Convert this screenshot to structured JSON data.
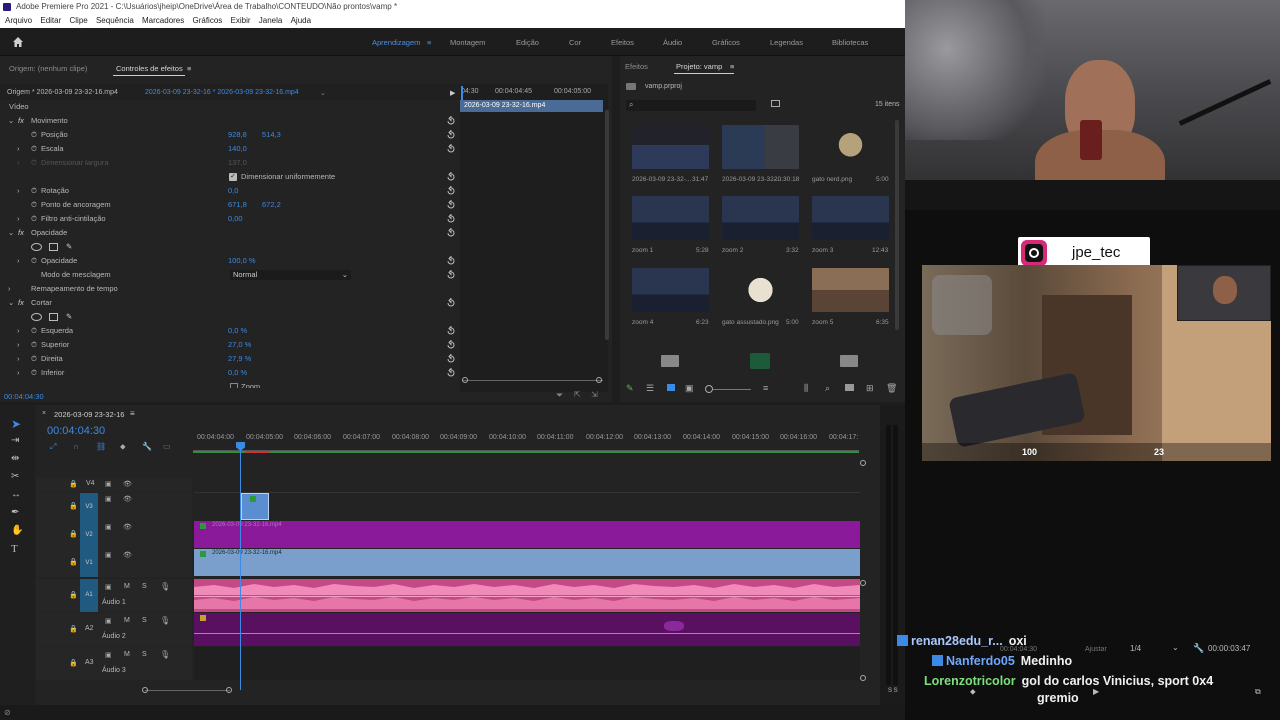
{
  "window": {
    "title": "Adobe Premiere Pro 2021 - C:\\Usuários\\jheip\\OneDrive\\Área de Trabalho\\CONTEUDO\\Não prontos\\vamp *"
  },
  "menu": [
    "Arquivo",
    "Editar",
    "Clipe",
    "Sequência",
    "Marcadores",
    "Gráficos",
    "Exibir",
    "Janela",
    "Ajuda"
  ],
  "workspaces": [
    {
      "label": "Aprendizagem",
      "active": true
    },
    {
      "label": "Montagem"
    },
    {
      "label": "Edição"
    },
    {
      "label": "Cor"
    },
    {
      "label": "Efeitos"
    },
    {
      "label": "Áudio"
    },
    {
      "label": "Gráficos"
    },
    {
      "label": "Legendas"
    },
    {
      "label": "Bibliotecas"
    }
  ],
  "effect_controls": {
    "tab_source": "Origem: (nenhum clipe)",
    "tab_active": "Controles de efeitos",
    "source_clip": "Origem * 2026-03-09 23-32-16.mp4",
    "sequence_clip": "2026-03-09 23-32-16 * 2026-03-09 23-32-16.mp4",
    "ruler_start": "04:30",
    "ruler_a": "00:04:04:45",
    "ruler_b": "00:04:05:00",
    "clip_name": "2026-03-09 23-32-16.mp4",
    "section_video": "Vídeo",
    "rows": {
      "movimento": "Movimento",
      "posicao": "Posição",
      "posicao_x": "928,8",
      "posicao_y": "514,3",
      "escala": "Escala",
      "escala_v": "140,0",
      "dim_largura": "Dimensionar largura",
      "dim_largura_v": "137,0",
      "dim_uniforme": "Dimensionar uniformemente",
      "rotacao": "Rotação",
      "rotacao_v": "0,0",
      "ancoragem": "Ponto de ancoragem",
      "ancoragem_x": "671,8",
      "ancoragem_y": "672,2",
      "filtro": "Filtro anti-cintilação",
      "filtro_v": "0,00",
      "opacidade": "Opacidade",
      "opacidade_prop": "Opacidade",
      "opacidade_v": "100,0 %",
      "modo": "Modo de mesclagem",
      "modo_v": "Normal",
      "remap": "Remapeamento de tempo",
      "cortar": "Cortar",
      "esquerda": "Esquerda",
      "esquerda_v": "0,0 %",
      "superior": "Superior",
      "superior_v": "27,0 %",
      "direita": "Direita",
      "direita_v": "27,9 %",
      "inferior": "Inferior",
      "inferior_v": "0,0 %",
      "zoom": "Zoom"
    },
    "current_time": "00:04:04:30"
  },
  "project": {
    "tab_effects": "Efeitos",
    "tab_project": "Projeto: vamp",
    "file": "vamp.prproj",
    "count": "15 itens",
    "items": [
      {
        "name": "2026-03-09 23-32-...",
        "dur": "31:47"
      },
      {
        "name": "2026-03-09 23-32-...",
        "dur": "20:30:18"
      },
      {
        "name": "gato nerd.png",
        "dur": "5:00"
      },
      {
        "name": "zoom 1",
        "dur": "5:28"
      },
      {
        "name": "zoom 2",
        "dur": "3:32"
      },
      {
        "name": "zoom 3",
        "dur": "12:43"
      },
      {
        "name": "zoom 4",
        "dur": "6:23"
      },
      {
        "name": "gato assustado.png",
        "dur": "5:00"
      },
      {
        "name": "zoom 5",
        "dur": "6:35"
      }
    ]
  },
  "timeline": {
    "sequence": "2026-03-09 23-32-16",
    "timecode": "00:04:04:30",
    "ruler": [
      "00:04:04:00",
      "00:04:05:00",
      "00:04:06:00",
      "00:04:07:00",
      "00:04:08:00",
      "00:04:09:00",
      "00:04:10:00",
      "00:04:11:00",
      "00:04:12:00",
      "00:04:13:00",
      "00:04:14:00",
      "00:04:15:00",
      "00:04:16:00",
      "00:04:17:"
    ],
    "tracks": [
      "V4",
      "V3",
      "V2",
      "V1",
      "A1",
      "A2",
      "A3"
    ],
    "audio_names": [
      "Áudio 1",
      "Áudio 2",
      "Áudio 3"
    ],
    "v1_clip": "2026-03-09 23-32-16.mp4",
    "v2_clip": "2026-03-09 23-32-16.mp4",
    "track_btn_m": "M",
    "track_btn_s": "S"
  },
  "program": {
    "page": "1/4",
    "duration": "00:00:03:47",
    "tc": "00:04:04:30",
    "fit": "Ajustar",
    "ss": "S S"
  },
  "stream": {
    "instagram": "jpe_tec",
    "hud_hp": "100",
    "hud_ammo": "23",
    "chat": [
      {
        "user": "renan28edu_r...",
        "msg": "oxi",
        "color": "#a9c8ff"
      },
      {
        "user": "Nanferdo05",
        "msg": "Medinho",
        "color": "#6fa8ff"
      },
      {
        "user": "Lorenzotricolor",
        "msg": "gol do carlos Vinicius, sport 0x4",
        "color": "#7be07b"
      },
      {
        "user": "",
        "msg": "gremio",
        "color": "#ffffff"
      }
    ]
  }
}
